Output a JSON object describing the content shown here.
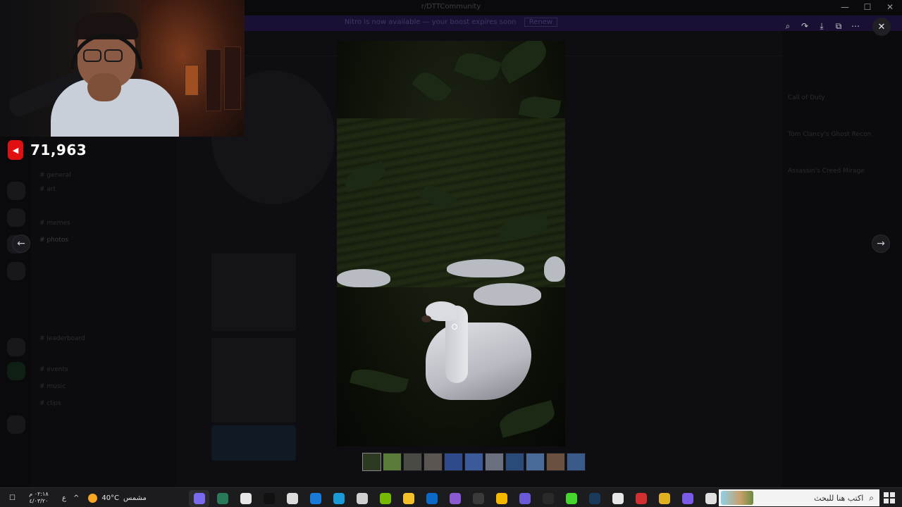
{
  "window": {
    "title": "r/DTTCommunity",
    "controls": [
      "—",
      "☐",
      "✕"
    ],
    "banner": "Nitro is now available — your boost expires soon",
    "banner_button": "Renew"
  },
  "background": {
    "channels": [
      "# photos",
      "# general",
      "# art",
      "# memes",
      "# leaderboard",
      "# events",
      "# music",
      "# clips"
    ],
    "members": [
      "Call of Duty",
      "Tom Clancy's Ghost Recon",
      "Assassin's Creed Mirage"
    ]
  },
  "stream_overlay": {
    "view_count": "71,963",
    "platform_icon": "youtube-icon",
    "platform_color": "#e01010"
  },
  "viewer": {
    "toolbar_icons": [
      "zoom-icon",
      "forward-icon",
      "download-icon",
      "open-external-icon",
      "more-icon"
    ],
    "toolbar_glyphs": [
      "⌕",
      "↷",
      "⤓",
      "⧉",
      "⋯"
    ],
    "close_glyph": "✕",
    "prev_glyph": "←",
    "next_glyph": "→",
    "thumb_colors": [
      "#2c3a22",
      "#5a7a3a",
      "#4a4a44",
      "#5a5550",
      "#2e4a8a",
      "#3a5a9a",
      "#6a7080",
      "#2a4a7a",
      "#4a6a9a",
      "#6a5040",
      "#3a5a8a"
    ]
  },
  "taskbar": {
    "search_placeholder": "اكتب هنا للبحث",
    "search_glyph": "⌕",
    "clock_time": "٠٢:١٨ م",
    "clock_date": "٤/٠٣/٢٠",
    "language": "ع",
    "tray_arrow": "^",
    "notify_glyph": "☐",
    "temperature": "40°C",
    "weather_condition": "مشمس",
    "pinned": [
      {
        "name": "start-icon",
        "color": "#7a6af0"
      },
      {
        "name": "terminal-icon",
        "color": "#2a7a5a"
      },
      {
        "name": "capcut-icon",
        "color": "#e6e6e6"
      },
      {
        "name": "tiktok-icon",
        "color": "#111111"
      },
      {
        "name": "openai-icon",
        "color": "#dcdcdc"
      },
      {
        "name": "mail-icon",
        "color": "#1a7ad8"
      },
      {
        "name": "edge-icon",
        "color": "#1a9ad8"
      },
      {
        "name": "cloud-icon",
        "color": "#d0d0d0"
      },
      {
        "name": "nvidia-icon",
        "color": "#76b900"
      },
      {
        "name": "file-explorer-icon",
        "color": "#f2c029"
      },
      {
        "name": "outlook-icon",
        "color": "#0a6ac8"
      },
      {
        "name": "obs-icon",
        "color": "#8a5ad0"
      },
      {
        "name": "xbox-icon",
        "color": "#3a3a3a"
      },
      {
        "name": "rockstar-icon",
        "color": "#f5b800"
      },
      {
        "name": "grid-app-icon",
        "color": "#6a5ad8"
      },
      {
        "name": "epic-games-icon",
        "color": "#2a2a2a"
      },
      {
        "name": "razer-icon",
        "color": "#44d62c"
      },
      {
        "name": "steam-icon",
        "color": "#1a3a5a"
      },
      {
        "name": "discord-icon",
        "color": "#e6e6e6"
      },
      {
        "name": "record-icon",
        "color": "#d03030"
      },
      {
        "name": "chrome-icon",
        "color": "#e0b020"
      },
      {
        "name": "copilot-icon",
        "color": "#7a5ae8"
      },
      {
        "name": "task-view-icon",
        "color": "#e0e0e0"
      }
    ]
  }
}
